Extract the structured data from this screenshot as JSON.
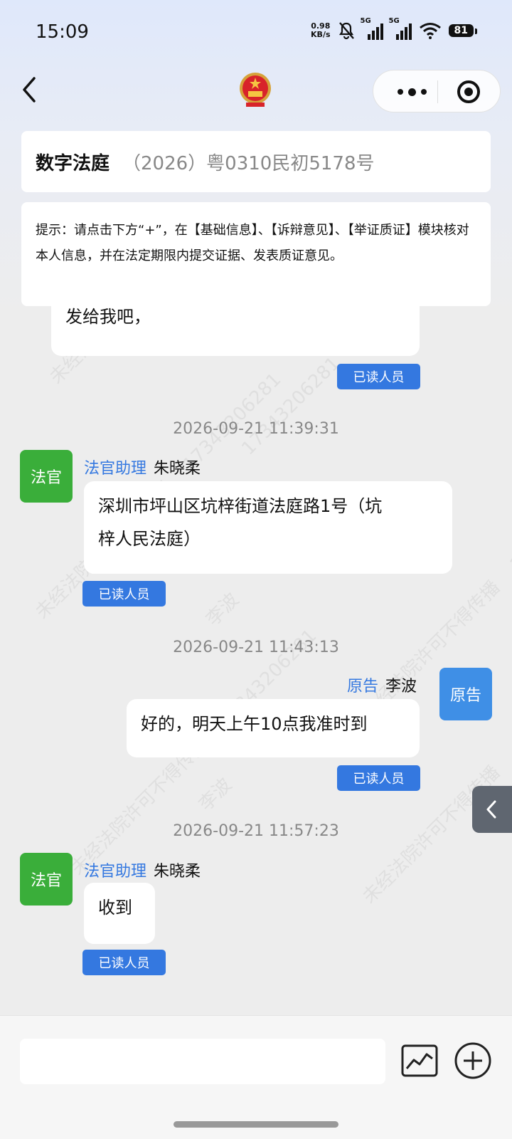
{
  "status": {
    "time": "15:09",
    "net_speed_value": "0.98",
    "net_speed_unit": "KB/s",
    "sim1": "5G",
    "sim2": "5G",
    "battery": "81"
  },
  "case": {
    "title": "数字法庭",
    "number": "（2026）粤0310民初5178号"
  },
  "tip": "提示：请点击下方“+”，在【基础信息】、【诉辩意见】、【举证质证】模块核对本人信息，并在法定期限内提交证据、发表质证意见。",
  "messages": [
    {
      "partial_text": "发给我吧，",
      "read_label": "已读人员"
    },
    {
      "timestamp": "2026-09-21 11:39:31",
      "avatar": "法官",
      "role": "法官助理",
      "name": "朱晓柔",
      "text_line1": "深圳市坪山区坑梓街道法庭路1号（坑",
      "text_line2": "梓人民法庭）",
      "read_label": "已读人员"
    },
    {
      "timestamp": "2026-09-21 11:43:13",
      "avatar": "原告",
      "role": "原告",
      "name": "李波",
      "text": "好的，明天上午10点我准时到",
      "read_label": "已读人员"
    },
    {
      "timestamp": "2026-09-21 11:57:23",
      "avatar": "法官",
      "role": "法官助理",
      "name": "朱晓柔",
      "text": "收到",
      "read_label": "已读人员"
    }
  ],
  "watermark": {
    "line": "未经法院许可不得传播",
    "phone": "17343206281",
    "name": "李波"
  },
  "input": {
    "placeholder": ""
  },
  "colors": {
    "accent": "#3478e0",
    "judge_avatar": "#3aae3a",
    "plaintiff_avatar": "#3f8fe6"
  }
}
